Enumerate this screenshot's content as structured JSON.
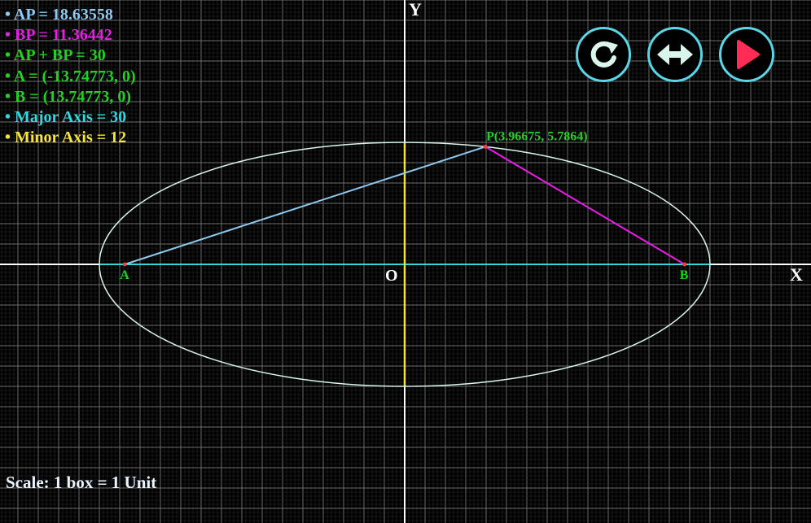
{
  "info": {
    "ap": {
      "text": "• AP = 18.63558",
      "color": "#8ec9f2"
    },
    "bp": {
      "text": "• BP = 11.36442",
      "color": "#e61ee6"
    },
    "sum": {
      "text": "• AP + BP = 30",
      "color": "#22d122"
    },
    "a": {
      "text": "• A = (-13.74773, 0)",
      "color": "#22d122"
    },
    "b": {
      "text": "• B = (13.74773, 0)",
      "color": "#22d122"
    },
    "major": {
      "text": "• Major Axis = 30",
      "color": "#35d6e0"
    },
    "minor": {
      "text": "• Minor Axis = 12",
      "color": "#f5e43a"
    }
  },
  "scale_text": "Scale: 1 box = 1 Unit",
  "axes": {
    "x_label": "X",
    "y_label": "Y",
    "origin_label": "O"
  },
  "diagram": {
    "semi_major": 15,
    "semi_minor": 6,
    "focus_a": {
      "label": "A",
      "x": -13.74773,
      "y": 0
    },
    "focus_b": {
      "label": "B",
      "x": 13.74773,
      "y": 0
    },
    "point_p": {
      "label": "P(3.96675, 5.7864)",
      "x": 3.96675,
      "y": 5.7864
    }
  },
  "buttons": {
    "reset": "refresh-icon",
    "swap": "double-arrow-icon",
    "play": "play-icon"
  },
  "colors": {
    "grid": "#5a5a5a",
    "axis": "#ffffff",
    "ellipse": "#d9f5ec",
    "ap_line": "#8ec9f2",
    "bp_line": "#e61ee6",
    "major_axis": "#35d6e0",
    "minor_axis": "#f5e43a",
    "point": "#ff3b3b",
    "label": "#22d122",
    "button_ring": "#5ad6e6",
    "play": "#ff2d55"
  }
}
